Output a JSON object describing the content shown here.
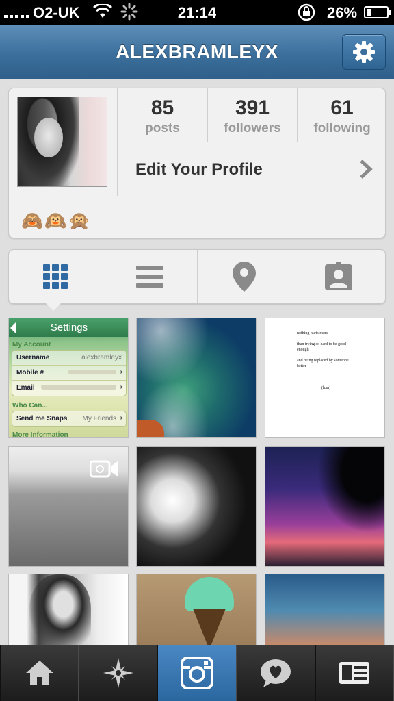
{
  "status_bar": {
    "carrier": "O2-UK",
    "time": "21:14",
    "battery_percent": "26%",
    "battery_level": 0.26
  },
  "header": {
    "title": "ALEXBRAMLEYX",
    "settings_icon": "gear-icon"
  },
  "profile": {
    "stats": [
      {
        "value": "85",
        "label": "posts"
      },
      {
        "value": "391",
        "label": "followers"
      },
      {
        "value": "61",
        "label": "following"
      }
    ],
    "edit_profile_label": "Edit Your Profile",
    "bio": "🙈🙉🙊"
  },
  "view_tabs": [
    {
      "name": "grid-view",
      "icon": "grid-icon",
      "selected": true
    },
    {
      "name": "list-view",
      "icon": "list-icon",
      "selected": false
    },
    {
      "name": "map-view",
      "icon": "location-pin-icon",
      "selected": false
    },
    {
      "name": "photos-of-you",
      "icon": "tagged-person-icon",
      "selected": false
    }
  ],
  "posts": {
    "settings_screenshot": {
      "title": "Settings",
      "section_account": "My Account",
      "rows": [
        {
          "label": "Username",
          "value": "alexbramleyx"
        },
        {
          "label": "Mobile #",
          "value": ""
        },
        {
          "label": "Email",
          "value": ""
        }
      ],
      "section_who": "Who Can...",
      "snaps_row": {
        "label": "Send me Snaps",
        "value": "My Friends"
      },
      "more_info": "More Information"
    },
    "quote": {
      "line1": "nothing hurts more",
      "line2": "than trying so hard to be good",
      "line3": "enough",
      "line4": "and being replaced by someone",
      "line5": "better",
      "sign": "(h.m)"
    }
  },
  "tab_bar": [
    {
      "name": "home",
      "icon": "home-icon",
      "active": false
    },
    {
      "name": "explore",
      "icon": "compass-star-icon",
      "active": false
    },
    {
      "name": "camera",
      "icon": "camera-icon",
      "active": true
    },
    {
      "name": "news",
      "icon": "heart-bubble-icon",
      "active": false
    },
    {
      "name": "profile",
      "icon": "profile-card-icon",
      "active": false
    }
  ],
  "colors": {
    "header_blue": "#3c6f9c",
    "tab_active_blue": "#2b679f",
    "grid_icon_blue": "#2f6aa3"
  }
}
